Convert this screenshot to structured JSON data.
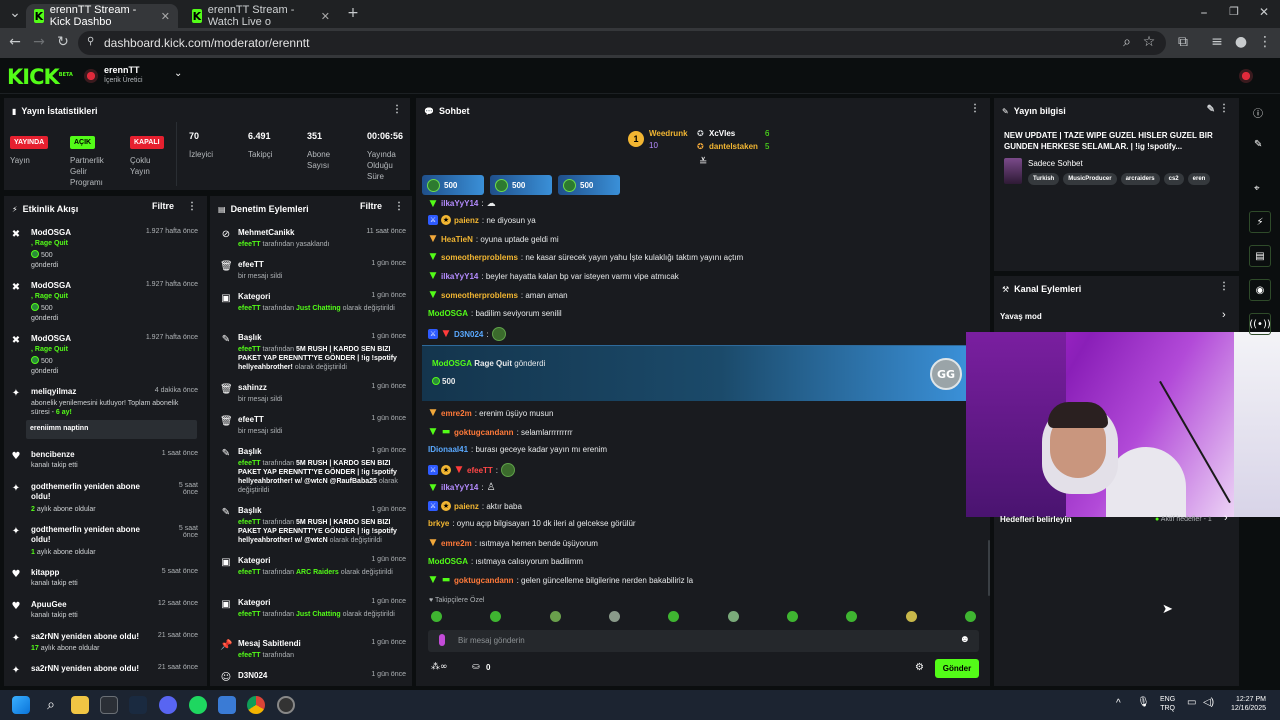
{
  "browser": {
    "tabs": [
      {
        "label": "erennTT Stream - Kick Dashbo"
      },
      {
        "label": "erennTT Stream - Watch Live o"
      }
    ],
    "url": "dashboard.kick.com/moderator/erenntt"
  },
  "header": {
    "logo": "KICK",
    "logo_beta": "BETA",
    "channel_name": "erennTT",
    "channel_role": "İçerik Üretici"
  },
  "stats_panel": {
    "title": "Yayın İstatistikleri",
    "badges": [
      {
        "badge": "YAYINDA",
        "label": "Yayın",
        "color": "#e6202f"
      },
      {
        "badge": "AÇIK",
        "label": "Partnerlik Gelir Programı",
        "color": "#53fc18"
      },
      {
        "badge": "KAPALI",
        "label": "Çoklu Yayın",
        "color": "#e6202f"
      }
    ],
    "stats": [
      {
        "value": "70",
        "label": "İzleyici"
      },
      {
        "value": "6.491",
        "label": "Takipçi"
      },
      {
        "value": "351",
        "label": "Abone Sayısı"
      },
      {
        "value": "00:06:56",
        "label": "Yayında Olduğu Süre"
      }
    ]
  },
  "activity_feed": {
    "title": "Etkinlik Akışı",
    "filter_label": "Filtre",
    "items": [
      {
        "name": "ModOSGA",
        "line1": ", Rage Quit",
        "amount": "500",
        "line2": "gönderdi",
        "time": "1.927 hafta önce"
      },
      {
        "name": "ModOSGA",
        "line1": ", Rage Quit",
        "amount": "500",
        "line2": "gönderdi",
        "time": "1.927 hafta önce"
      },
      {
        "name": "ModOSGA",
        "line1": ", Rage Quit",
        "amount": "500",
        "line2": "gönderdi",
        "time": "1.927 hafta önce"
      },
      {
        "name": "meliqyilmaz",
        "desc": "abonelik yenilemesini kutluyor! Toplam abonelik süresi - ",
        "months": "6 ay!",
        "message": "ereniimm naptinn",
        "time": "4 dakika önce"
      },
      {
        "name": "bencibenze",
        "desc": "kanalı takip etti",
        "time": "1 saat önce"
      },
      {
        "name": "godthemerlin yeniden abone oldu!",
        "months": "2",
        "desc": " aylık abone oldular",
        "time": "5 saat önce"
      },
      {
        "name": "godthemerlin yeniden abone oldu!",
        "months": "1",
        "desc": " aylık abone oldular",
        "time": "5 saat önce"
      },
      {
        "name": "kitappp",
        "desc": "kanalı takip etti",
        "time": "5 saat önce"
      },
      {
        "name": "ApuuGee",
        "desc": "kanalı takip etti",
        "time": "12 saat önce"
      },
      {
        "name": "sa2rNN yeniden abone oldu!",
        "months": "17",
        "desc": " aylık abone oldular",
        "time": "21 saat önce"
      },
      {
        "name": "sa2rNN yeniden abone oldu!",
        "time": "21 saat önce"
      }
    ]
  },
  "moderation": {
    "title": "Denetim Eylemleri",
    "filter_label": "Filtre",
    "items": [
      {
        "title": "MehmetCanikk",
        "user": "efeeTT",
        "text": " tarafından yasaklandı",
        "time": "11 saat önce"
      },
      {
        "title": "efeeTT",
        "text": "bir mesajı sildi",
        "time": "1 gün önce"
      },
      {
        "title": "Kategori",
        "user": "efeeTT",
        "text": " tarafından ",
        "highlight": "Just Chatting",
        "text2": " olarak değiştirildi",
        "time": "1 gün önce"
      },
      {
        "title": "Başlık",
        "user": "efeeTT",
        "text": " tarafından ",
        "highlight": "5M RUSH | KARDO SEN BIZI PAKET YAP ERENNTT'YE GÖNDER | !ig !spotify hellyeahbrother!",
        "text2": " olarak değiştirildi",
        "time": "1 gün önce"
      },
      {
        "title": "sahinzz",
        "text": "bir mesajı sildi",
        "time": "1 gün önce"
      },
      {
        "title": "efeeTT",
        "text": "bir mesajı sildi",
        "time": "1 gün önce"
      },
      {
        "title": "Başlık",
        "user": "efeeTT",
        "text": " tarafından ",
        "highlight": "5M RUSH | KARDO SEN BIZI PAKET YAP ERENNTT'YE GÖNDER | !ig !spotify hellyeahbrother! w/ @wtcN @RaufBaba25",
        "text2": " olarak değiştirildi",
        "time": "1 gün önce"
      },
      {
        "title": "Başlık",
        "user": "efeeTT",
        "text": " tarafından ",
        "highlight": "5M RUSH | KARDO SEN BIZI PAKET YAP ERENNTT'YE GÖNDER | !ig !spotify hellyeahbrother! w/ @wtcN",
        "text2": " olarak değiştirildi",
        "time": "1 gün önce"
      },
      {
        "title": "Kategori",
        "user": "efeeTT",
        "text": " tarafından ",
        "highlight": "ARC Raiders",
        "text2": " olarak değiştirildi",
        "time": "1 gün önce"
      },
      {
        "title": "Kategori",
        "user": "efeeTT",
        "text": " tarafından ",
        "highlight": "Just Chatting",
        "text2": " olarak değiştirildi",
        "time": "1 gün önce"
      },
      {
        "title": "Mesaj Sabitlendi",
        "user": "efeeTT",
        "text": " tarafından",
        "time": "1 gün önce"
      },
      {
        "title": "D3N024",
        "time": "1 gün önce"
      }
    ]
  },
  "chat": {
    "title": "Sohbet",
    "leaderboard": [
      {
        "name": "Weedrunk",
        "count": "10"
      },
      {
        "name": "XcVles",
        "count": "6"
      },
      {
        "name": "dantelstaken",
        "count": "5"
      }
    ],
    "gift_pills": [
      "500",
      "500",
      "500"
    ],
    "messages": [
      {
        "user": "ilkaYyY14",
        "text": ":",
        "color": "#b58cff"
      },
      {
        "user": "paienz",
        "text": ": ne diyosun ya",
        "color": "#f2b632"
      },
      {
        "user": "HeaTieN",
        "text": ": oyuna uptade geldi mi",
        "color": "#f2b632"
      },
      {
        "user": "someotherproblems",
        "text": ": ne kasar sürecek yayın yahu İşte kulaklığı taktım yayını açtım",
        "color": "#f2b632"
      },
      {
        "user": "ilkaYyY14",
        "text": ": beyler hayatta kalan bp var isteyen varmı vipe atmıcak",
        "color": "#b58cff"
      },
      {
        "user": "someotherproblems",
        "text": ": aman aman",
        "color": "#f2b632"
      },
      {
        "user": "ModOSGA",
        "text": ": badilim seviyorum senilil",
        "color": "#53fc18"
      },
      {
        "user": "D3N024",
        "text": ":",
        "color": "#5aa9ff"
      },
      {
        "user": "emre2m",
        "text": ": erenim üşüyo musun",
        "color": "#ff7a3a"
      },
      {
        "user": "goktugcandann",
        "text": ": selamlarrrrrrrrr",
        "color": "#ff7a3a"
      },
      {
        "user": "IDionaal41",
        "text": ": burası geceye kadar yayın mı erenim",
        "color": "#5aa9ff"
      },
      {
        "user": "efeeTT",
        "text": ":",
        "color": "#ff4747"
      },
      {
        "user": "ilkaYyY14",
        "text": ":",
        "color": "#b58cff"
      },
      {
        "user": "paienz",
        "text": ": aktır baba",
        "color": "#f2b632"
      },
      {
        "user": "brkye",
        "text": ": oynu açıp bilgisayarı 10 dk ileri al gelcekse görülür",
        "color": "#f2b632"
      },
      {
        "user": "emre2m",
        "text": ": ısıtmaya hemen bende üşüyorum",
        "color": "#ff7a3a"
      },
      {
        "user": "ModOSGA",
        "text": ": ısıtmaya calısıyorum badilimm",
        "color": "#53fc18"
      },
      {
        "user": "goktugcandann",
        "text": ": gelen güncelleme bilgilerine nerden bakabiliriz la",
        "color": "#ff7a3a"
      }
    ],
    "gift_banner": {
      "user": "ModOSGA",
      "gift": "Rage Quit",
      "text": "gönderdi",
      "amount": "500"
    },
    "followers_label": "Takipçilere Özel",
    "input_placeholder": "Bir mesaj gönderin",
    "points_value": "0",
    "send_label": "Gönder"
  },
  "stream_info": {
    "title": "Yayın bilgisi",
    "stream_title": "NEW UPDATE | TAZE WIPE GUZEL HISLER GUZEL BIR GUNDEN HERKESE SELAMLAR. | !ig !spotify...",
    "category": "Sadece Sohbet",
    "tags": [
      "Turkish",
      "MusicProducer",
      "arcraiders",
      "cs2",
      "eren"
    ]
  },
  "channel_actions": {
    "title": "Kanal Eylemleri",
    "slow_mode": "Yavaş mod",
    "goals_label": "Hedefleri belirleyin",
    "goals_status": "Aktif hedefler - 1"
  },
  "taskbar": {
    "language": "ENG",
    "layout": "TRQ",
    "time": "12:27 PM",
    "date": "12/16/2025"
  },
  "colors": {
    "kick_green": "#53fc18",
    "panel_bg": "#191b1f",
    "live_red": "#e6202f"
  }
}
